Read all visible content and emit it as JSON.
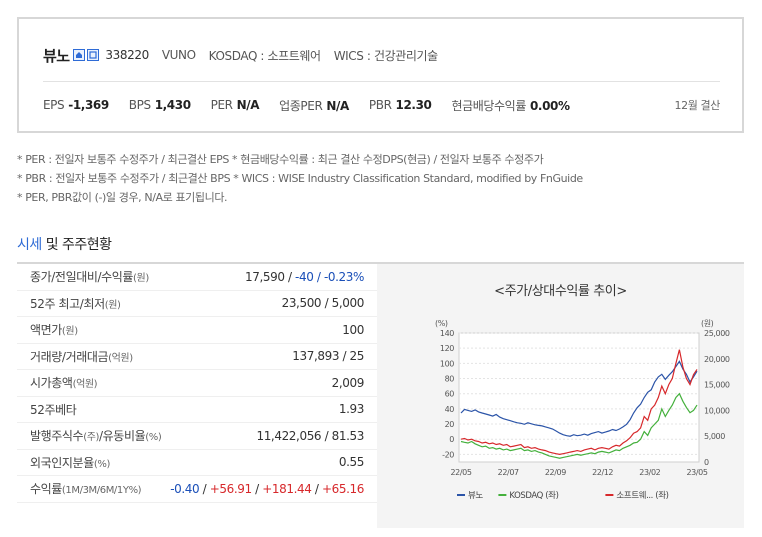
{
  "company": {
    "name": "뷰노",
    "code": "338220",
    "english_name": "VUNO",
    "market": "KOSDAQ : 소프트웨어",
    "wics": "WICS : 건강관리기술"
  },
  "stats": [
    {
      "label": "EPS",
      "value": "-1,369"
    },
    {
      "label": "BPS",
      "value": "1,430"
    },
    {
      "label": "PER",
      "value": "N/A"
    },
    {
      "label": "업종PER",
      "value": "N/A"
    },
    {
      "label": "PBR",
      "value": "12.30"
    },
    {
      "label": "현금배당수익률",
      "value": "0.00%"
    }
  ],
  "settlement": "12월 결산",
  "notes": [
    "* PER : 전일자 보통주 수정주가 / 최근결산 EPS * 현금배당수익률 : 최근 결산 수정DPS(현금) / 전일자 보통주 수정주가",
    "* PBR : 전일자 보통주 수정주가 / 최근결산 BPS * WICS : WISE Industry Classification Standard, modified by FnGuide",
    "* PER, PBR값이 (-)일 경우, N/A로 표기됩니다."
  ],
  "section": {
    "title_highlight": "시세",
    "title_rest": " 및 주주현황"
  },
  "table": {
    "rows": [
      {
        "label": "종가/전일대비/수익률",
        "unit": "(원)",
        "label_tail": ""
      },
      {
        "label": "52주 최고/최저",
        "unit": "(원)",
        "value": "23,500 / 5,000"
      },
      {
        "label": "액면가",
        "unit": "(원)",
        "value": "100"
      },
      {
        "label": "거래량/거래대금",
        "unit": "(억원)",
        "value": "137,893 / 25"
      },
      {
        "label": "시가총액",
        "unit": "(억원)",
        "value": "2,009"
      },
      {
        "label": "52주베타",
        "unit": "",
        "value": "1.93"
      },
      {
        "label": "발행주식수",
        "unit": "(주)",
        "label_mid": "/유동비율",
        "unit2": "(%)",
        "value": "11,422,056 / 81.53"
      },
      {
        "label": "외국인지분율",
        "unit": "(%)",
        "value": "0.55"
      },
      {
        "label": "수익률",
        "unit": "(1M/3M/6M/1Y%)",
        "value": ""
      }
    ],
    "close": {
      "price": "17,590",
      "change": "-40",
      "rate": "-0.23%"
    },
    "returns": {
      "m1": "-0.40",
      "m3": "+56.91",
      "m6": "+181.44",
      "y1": "+65.16"
    }
  },
  "chart_data": {
    "type": "line",
    "title": "<주가/상대수익률 추이>",
    "left_unit": "(%)",
    "right_unit": "(원)",
    "x_ticks": [
      "22/05",
      "22/07",
      "22/09",
      "22/12",
      "23/02",
      "23/05"
    ],
    "left_ticks": [
      140,
      120,
      100,
      80,
      60,
      40,
      20,
      0,
      -20
    ],
    "right_ticks": [
      "25,000",
      "20,000",
      "15,000",
      "10,000",
      "5,000",
      "0"
    ],
    "left_ylim": [
      -30,
      140
    ],
    "right_ylim": [
      0,
      25000
    ],
    "series": [
      {
        "name": "뷰노",
        "axis": "right",
        "color": "#2b54a8",
        "values": [
          9500,
          10200,
          10000,
          9800,
          10100,
          9700,
          9500,
          9300,
          9100,
          8900,
          9200,
          8700,
          8400,
          8200,
          8000,
          7800,
          7600,
          7500,
          7300,
          7600,
          7400,
          7200,
          7100,
          7000,
          6800,
          6600,
          6400,
          6000,
          5600,
          5300,
          5100,
          5000,
          5300,
          5100,
          5200,
          5400,
          5200,
          5500,
          5700,
          5900,
          5600,
          5800,
          6000,
          6300,
          6100,
          6400,
          6800,
          7300,
          8200,
          9500,
          10500,
          11200,
          12500,
          13500,
          14000,
          15500,
          16500,
          17000,
          16000,
          16800,
          17500,
          18500,
          19500,
          18000,
          17000,
          15500,
          16500,
          17590
        ]
      },
      {
        "name": "KOSDAQ (좌)",
        "axis": "left",
        "color": "#44b03c",
        "values": [
          -3,
          -4,
          -5,
          -3,
          -6,
          -8,
          -10,
          -9,
          -12,
          -11,
          -13,
          -12,
          -14,
          -13,
          -15,
          -14,
          -13,
          -12,
          -15,
          -14,
          -16,
          -15,
          -17,
          -18,
          -20,
          -22,
          -23,
          -24,
          -25,
          -24,
          -23,
          -22,
          -21,
          -20,
          -21,
          -20,
          -19,
          -18,
          -19,
          -17,
          -16,
          -17,
          -18,
          -16,
          -14,
          -15,
          -12,
          -10,
          -8,
          -5,
          -4,
          0,
          10,
          5,
          15,
          20,
          25,
          40,
          30,
          38,
          45,
          55,
          60,
          50,
          42,
          35,
          38,
          45
        ]
      },
      {
        "name": "소프트웨... (좌)",
        "axis": "left",
        "color": "#d7282b",
        "values": [
          0,
          1,
          -1,
          0,
          -2,
          -3,
          -5,
          -4,
          -6,
          -5,
          -7,
          -6,
          -8,
          -7,
          -10,
          -9,
          -8,
          -7,
          -11,
          -10,
          -12,
          -11,
          -13,
          -14,
          -15,
          -17,
          -18,
          -19,
          -20,
          -19,
          -18,
          -17,
          -16,
          -15,
          -16,
          -14,
          -13,
          -12,
          -14,
          -12,
          -11,
          -12,
          -13,
          -10,
          -8,
          -9,
          -5,
          -2,
          2,
          8,
          10,
          15,
          30,
          25,
          40,
          45,
          55,
          70,
          60,
          72,
          80,
          100,
          118,
          95,
          80,
          72,
          85,
          92
        ]
      }
    ]
  }
}
